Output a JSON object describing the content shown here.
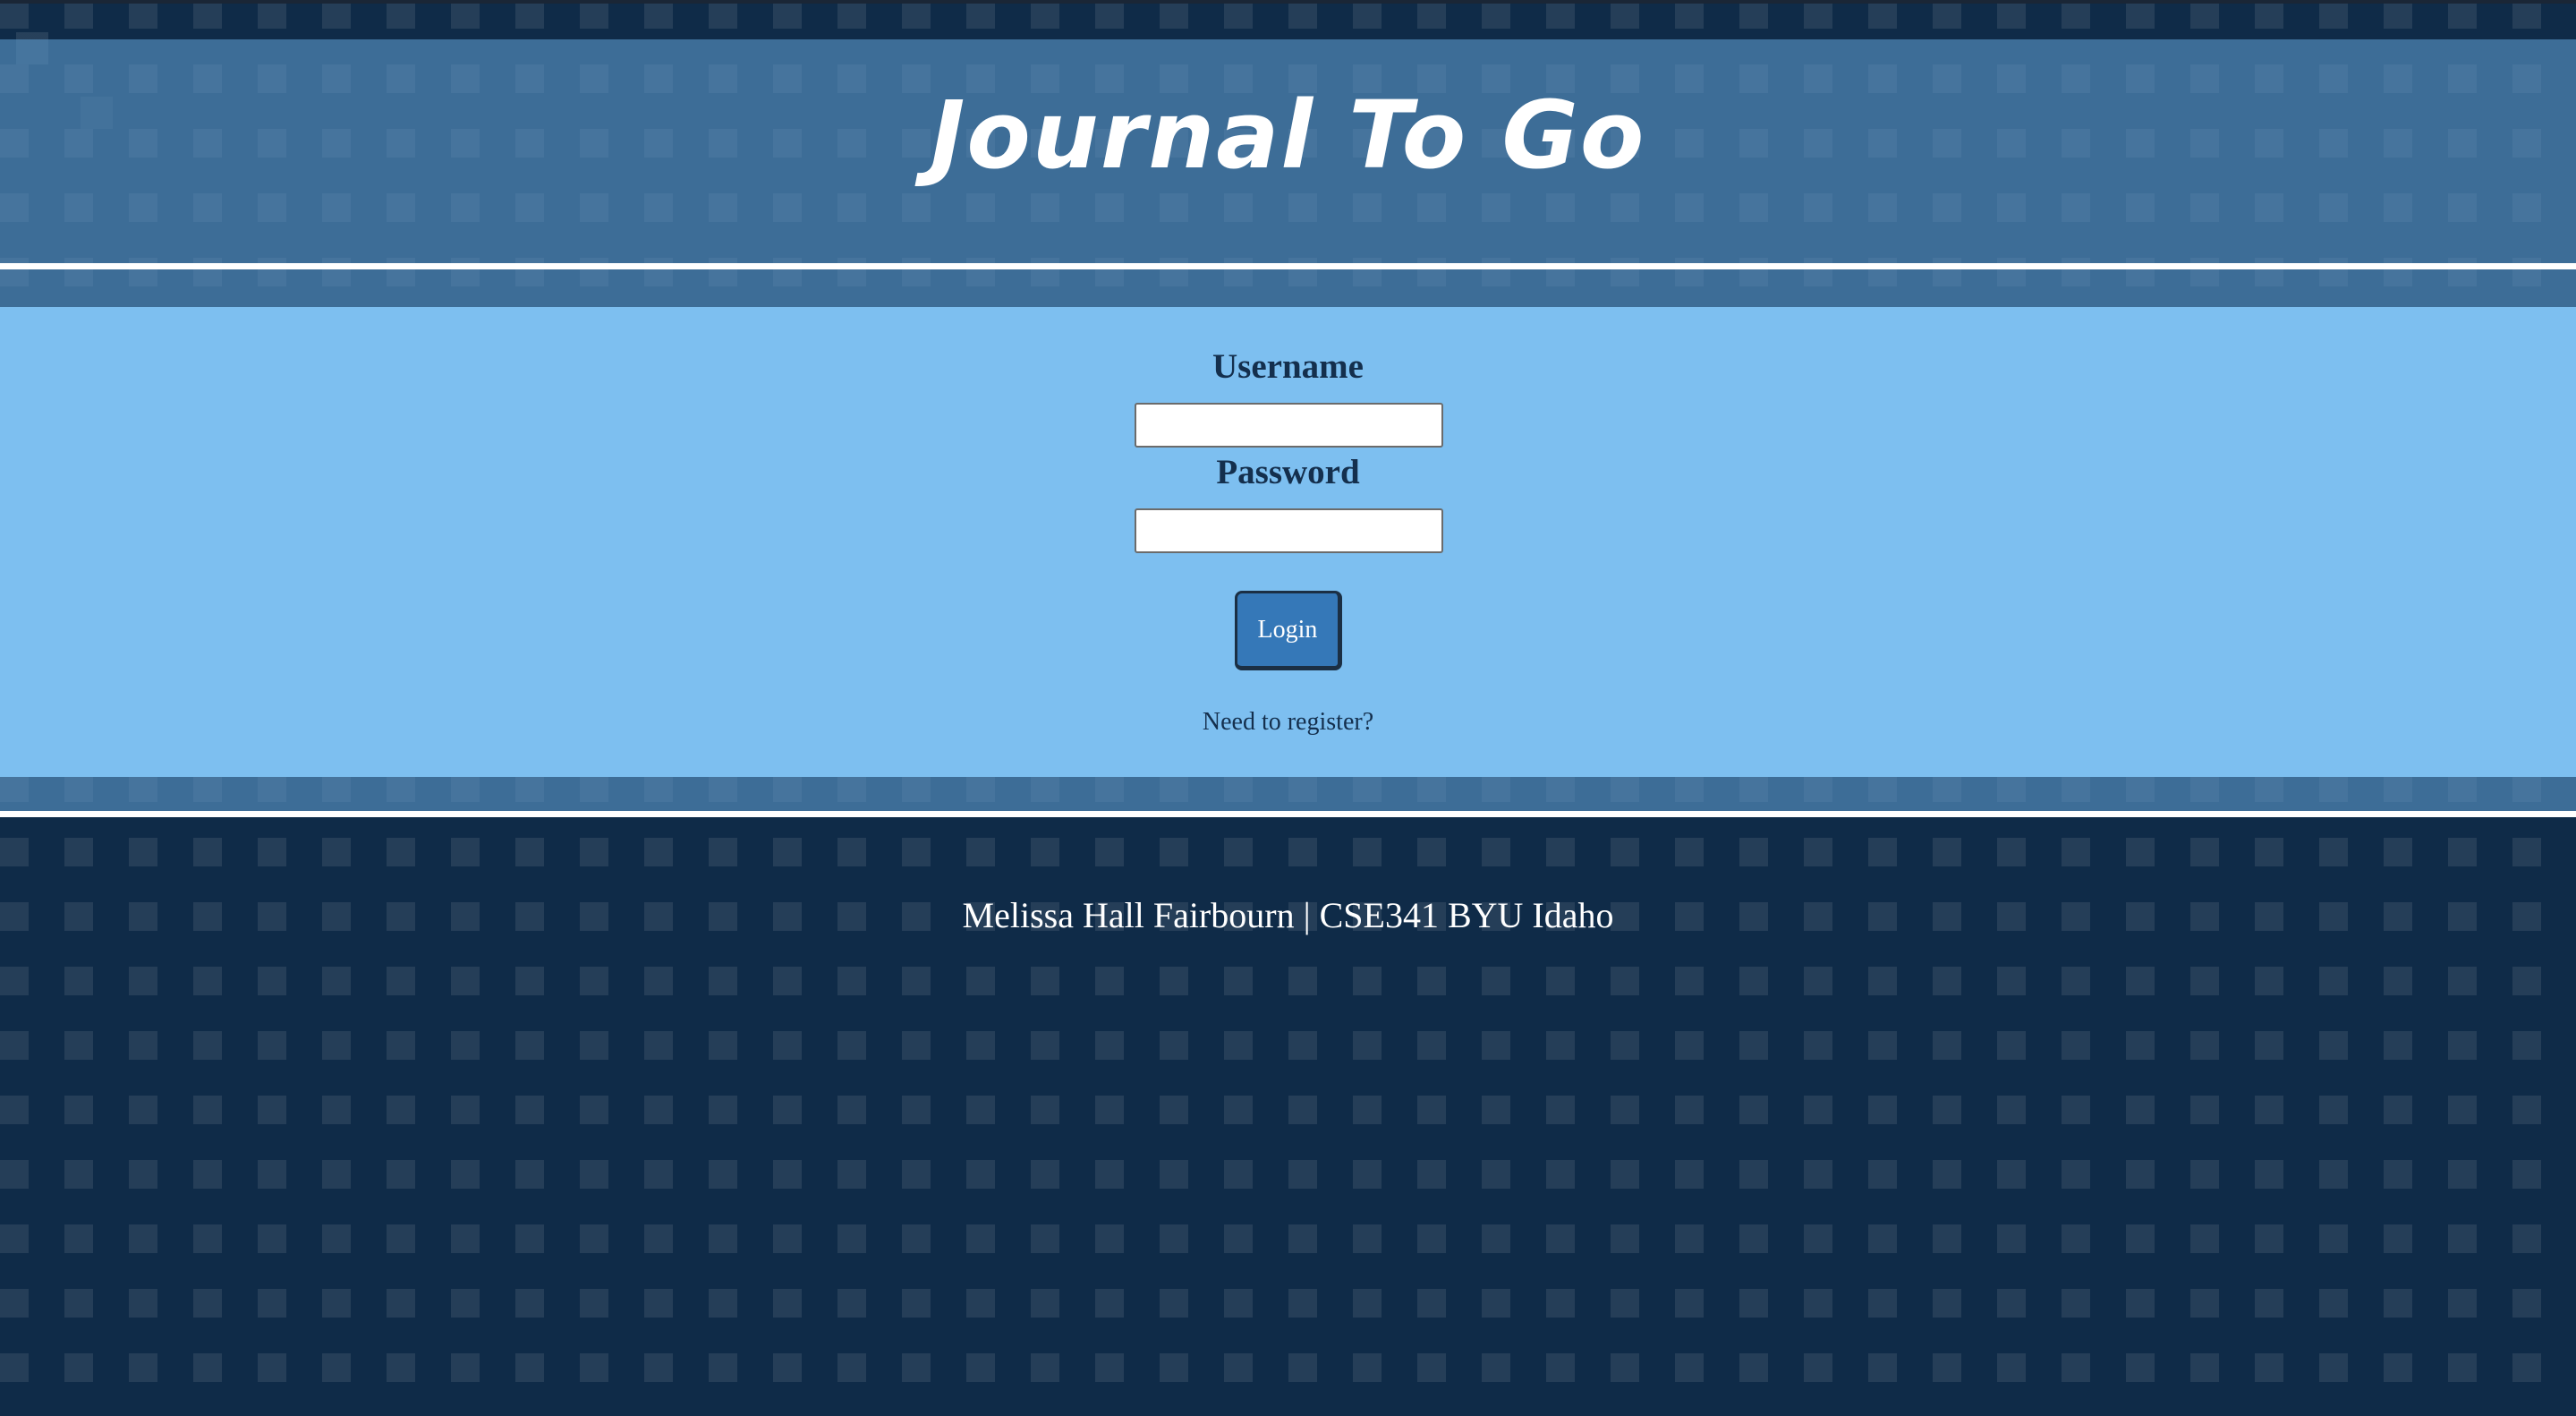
{
  "header": {
    "title": "Journal To Go"
  },
  "login_form": {
    "username_label": "Username",
    "username_value": "",
    "password_label": "Password",
    "password_value": "",
    "login_button": "Login",
    "register_link": "Need to register?"
  },
  "footer": {
    "text": "Melissa Hall Fairbourn | CSE341 BYU Idaho"
  },
  "colors": {
    "page_background": "#0f2b48",
    "header_band": "#5a96c8",
    "main_panel": "#7dbff0",
    "login_button": "#3578b8",
    "text_dark": "#142f4d"
  }
}
